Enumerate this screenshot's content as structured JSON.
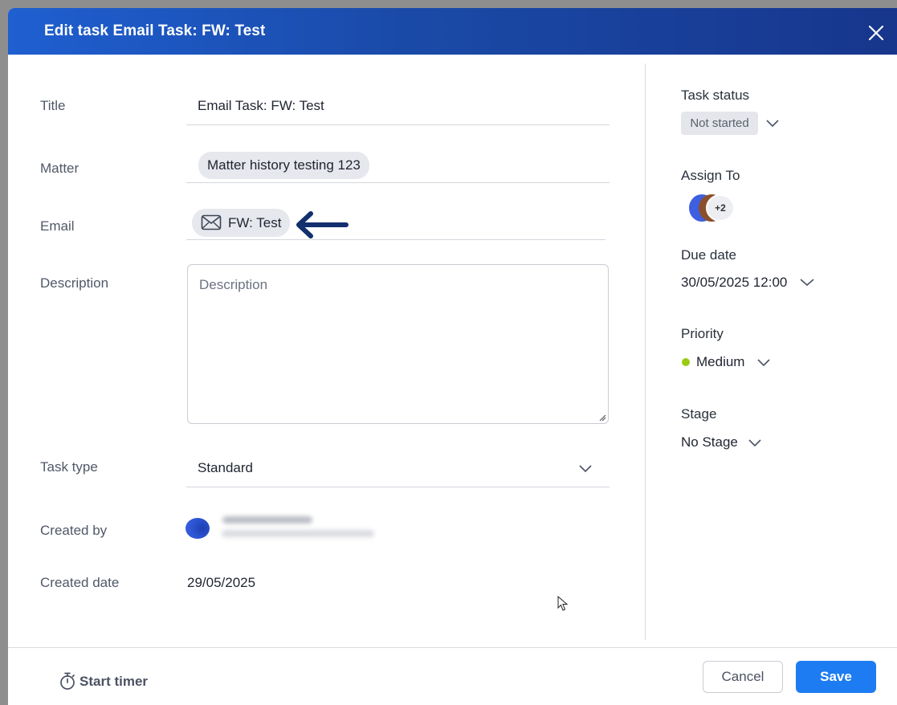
{
  "header": {
    "title": "Edit task Email Task: FW: Test"
  },
  "form": {
    "title": {
      "label": "Title",
      "value": "Email Task: FW: Test"
    },
    "matter": {
      "label": "Matter",
      "value": "Matter history testing 123"
    },
    "email": {
      "label": "Email",
      "value": "FW: Test",
      "icon": "mail-icon"
    },
    "description": {
      "label": "Description",
      "placeholder": "Description"
    },
    "task_type": {
      "label": "Task type",
      "value": "Standard"
    },
    "created_by": {
      "label": "Created by"
    },
    "created_date": {
      "label": "Created date",
      "value": "29/05/2025"
    }
  },
  "side": {
    "task_status": {
      "label": "Task status",
      "value": "Not started"
    },
    "assign_to": {
      "label": "Assign To",
      "more": "+2"
    },
    "due_date": {
      "label": "Due date",
      "value": "30/05/2025 12:00"
    },
    "priority": {
      "label": "Priority",
      "value": "Medium",
      "color": "#9acb14"
    },
    "stage": {
      "label": "Stage",
      "value": "No Stage"
    }
  },
  "footer": {
    "start_timer": "Start timer",
    "cancel": "Cancel",
    "save": "Save"
  },
  "colors": {
    "header_start": "#1f5fd0",
    "header_end": "#17368c",
    "primary_button": "#1d7cf2",
    "arrow": "#13306e"
  }
}
